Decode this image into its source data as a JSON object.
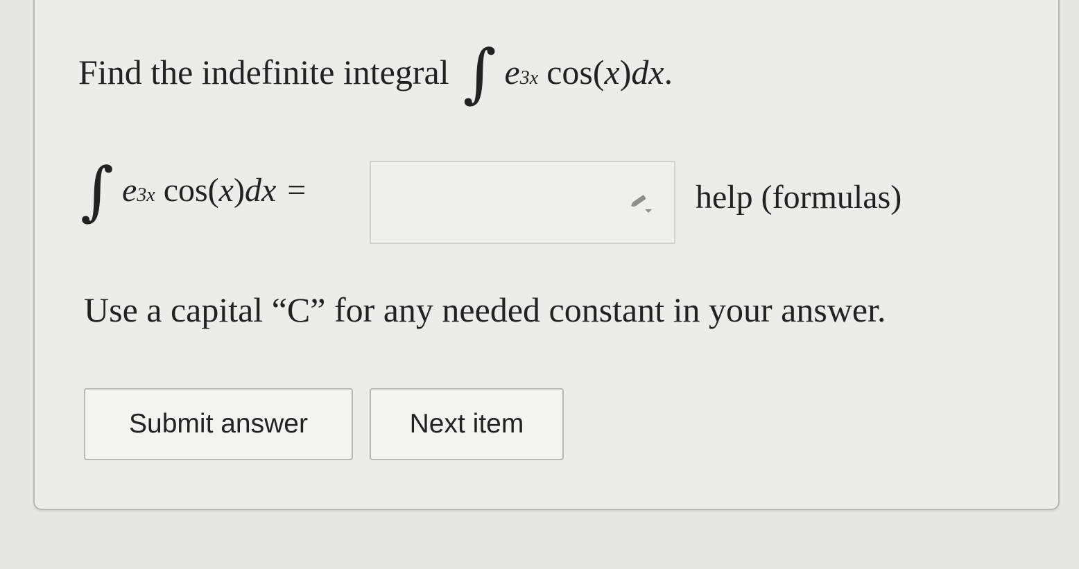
{
  "question": {
    "prefix": "Find the indefinite integral",
    "integral_symbol": "∫",
    "base": "e",
    "exponent": "3x",
    "cos": "cos(",
    "variable": "x",
    "close_paren": ")",
    "dx": "dx",
    "period": "."
  },
  "answer_row": {
    "integral_symbol": "∫",
    "base": "e",
    "exponent": "3x",
    "cos": "cos(",
    "variable": "x",
    "close_paren": ")",
    "dx": "dx",
    "equals": "=",
    "input_value": "",
    "help_label": "help (formulas)"
  },
  "note": "Use a capital “C” for any needed constant in your answer.",
  "buttons": {
    "submit": "Submit answer",
    "next": "Next item"
  },
  "icons": {
    "pencil": "pencil-dropdown-icon"
  }
}
